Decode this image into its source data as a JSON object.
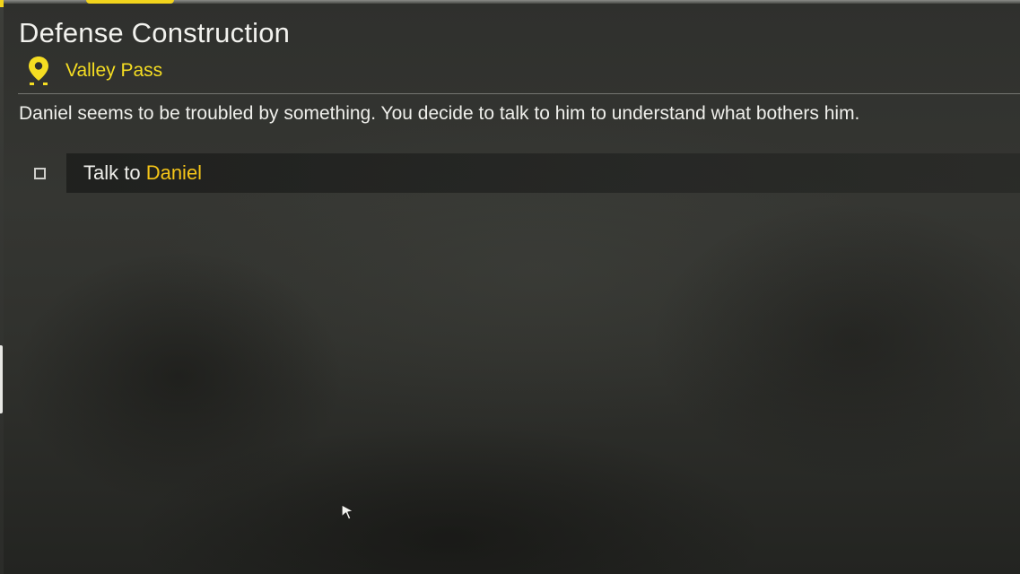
{
  "quest": {
    "title": "Defense Construction",
    "location": "Valley Pass",
    "description": "Daniel seems to be troubled by something. You decide to talk to him to understand what bothers him.",
    "objectives": [
      {
        "verb": "Talk to ",
        "target": "Daniel",
        "completed": false
      }
    ]
  },
  "icons": {
    "location": "map-pin-icon",
    "objective": "checkbox-icon",
    "cursor": "mouse-cursor-icon"
  },
  "colors": {
    "accent_yellow": "#f5dd22",
    "target_yellow": "#f5c518",
    "text_white": "#efefeb"
  }
}
